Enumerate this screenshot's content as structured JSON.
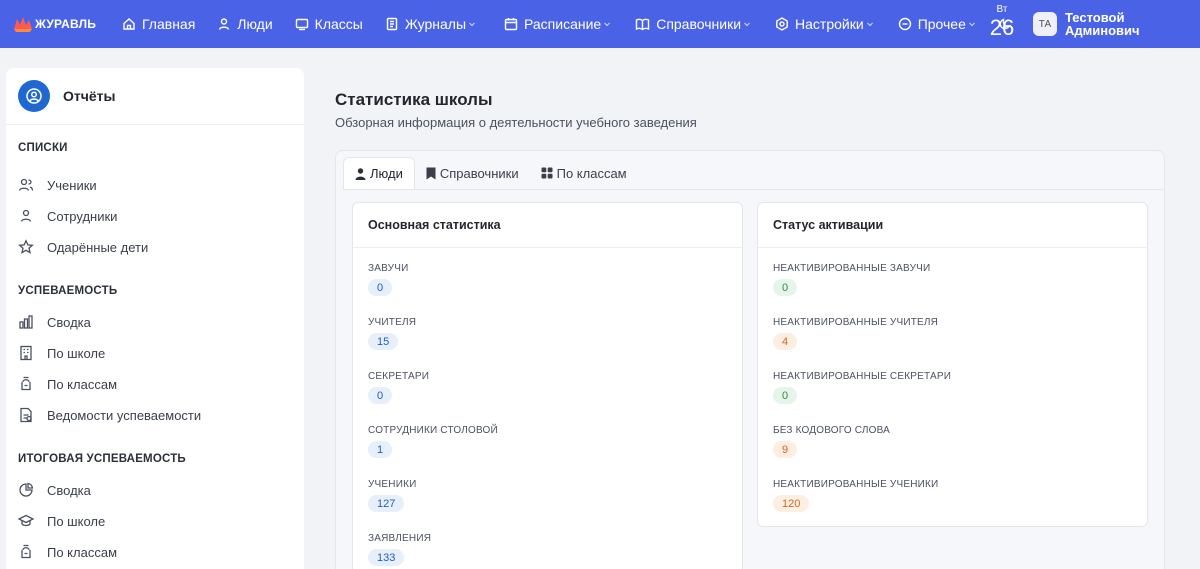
{
  "app": {
    "logo_text": "ЖУРАВЛЬ",
    "brand_color": "#4a63e6"
  },
  "nav": {
    "items": [
      {
        "label": "Главная",
        "icon": "home-icon"
      },
      {
        "label": "Люди",
        "icon": "person-icon"
      },
      {
        "label": "Классы",
        "icon": "classroom-icon"
      },
      {
        "label": "Журналы",
        "icon": "journal-icon",
        "dropdown": true
      },
      {
        "label": "Расписание",
        "icon": "calendar-icon",
        "dropdown": true
      },
      {
        "label": "Справочники",
        "icon": "book-icon",
        "dropdown": true
      },
      {
        "label": "Настройки",
        "icon": "gear-icon",
        "dropdown": true
      },
      {
        "label": "Прочее",
        "icon": "more-icon",
        "dropdown": true
      }
    ],
    "theme_toggle_icon": "moon-icon",
    "date_weekday": "Вт",
    "date_day": "26",
    "user_initials": "ТА",
    "user_name_line1": "Тестовой",
    "user_name_line2": "Админович"
  },
  "sidebar": {
    "title": "Отчёты",
    "sections": [
      {
        "title": "СПИСКИ",
        "items": [
          {
            "label": "Ученики",
            "icon": "users-icon"
          },
          {
            "label": "Сотрудники",
            "icon": "person-icon"
          },
          {
            "label": "Одарённые дети",
            "icon": "star-icon"
          }
        ]
      },
      {
        "title": "УСПЕВАЕМОСТЬ",
        "items": [
          {
            "label": "Сводка",
            "icon": "bar-chart-icon"
          },
          {
            "label": "По школе",
            "icon": "building-icon"
          },
          {
            "label": "По классам",
            "icon": "class-icon"
          },
          {
            "label": "Ведомости успеваемости",
            "icon": "document-icon"
          }
        ]
      },
      {
        "title": "ИТОГОВАЯ УСПЕВАЕМОСТЬ",
        "items": [
          {
            "label": "Сводка",
            "icon": "pie-chart-icon"
          },
          {
            "label": "По школе",
            "icon": "graduation-cap-icon"
          },
          {
            "label": "По классам",
            "icon": "class-icon"
          }
        ]
      }
    ]
  },
  "main": {
    "title": "Статистика школы",
    "subtitle": "Обзорная информация о деятельности учебного заведения",
    "tabs": [
      {
        "label": "Люди",
        "icon": "person-icon",
        "active": true
      },
      {
        "label": "Справочники",
        "icon": "bookmark-icon",
        "active": false
      },
      {
        "label": "По классам",
        "icon": "grid-icon",
        "active": false
      }
    ],
    "basic_stats": {
      "title": "Основная статистика",
      "rows": [
        {
          "label": "Завучи",
          "value": "0"
        },
        {
          "label": "Учителя",
          "value": "15"
        },
        {
          "label": "Секретари",
          "value": "0"
        },
        {
          "label": "Сотрудники столовой",
          "value": "1"
        },
        {
          "label": "Ученики",
          "value": "127"
        },
        {
          "label": "Заявления",
          "value": "133"
        }
      ]
    },
    "activation_status": {
      "title": "Статус активации",
      "rows": [
        {
          "label": "Неактивированные завучи",
          "value": "0",
          "status": "green"
        },
        {
          "label": "Неактивированные учителя",
          "value": "4",
          "status": "orange"
        },
        {
          "label": "Неактивированные секретари",
          "value": "0",
          "status": "green"
        },
        {
          "label": "Без кодового слова",
          "value": "9",
          "status": "orange"
        },
        {
          "label": "Неактивированные ученики",
          "value": "120",
          "status": "orange"
        }
      ]
    }
  }
}
